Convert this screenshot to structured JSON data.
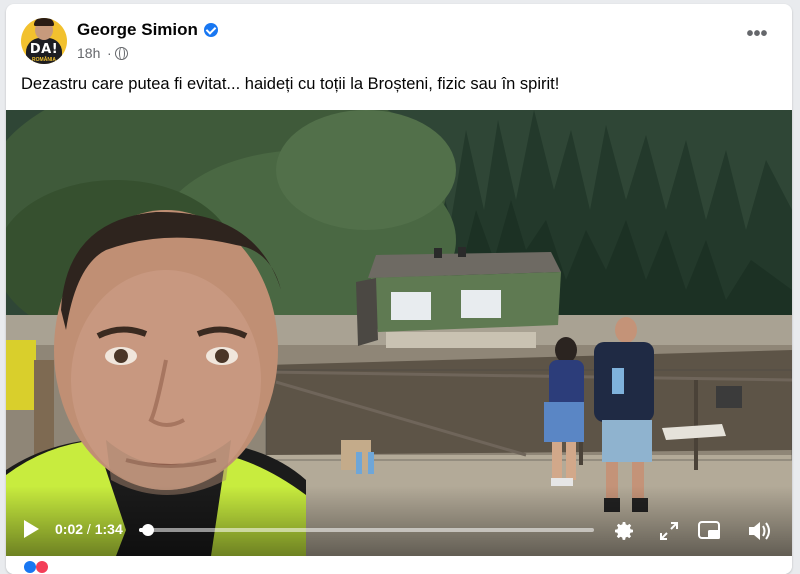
{
  "post": {
    "author": "George Simion",
    "time": "18h",
    "separator": "·",
    "text": "Dezastru care putea fi evitat... haideți cu toții la Broșteni, fizic sau în spirit!",
    "avatar_text": "DA!",
    "avatar_subtext": "ROMÂNIA"
  },
  "video": {
    "current_time": "0:02",
    "time_separator": "/",
    "duration": "1:34",
    "progress": 0.02
  },
  "icons": {
    "verified": "verified-badge-icon",
    "privacy": "globe-icon",
    "more": "more-options-icon",
    "play": "play-icon",
    "settings": "gear-icon",
    "fullscreen": "expand-icon",
    "pip": "picture-in-picture-icon",
    "volume": "volume-icon"
  },
  "colors": {
    "accent": "#1877f2",
    "vest": "#d8f53a"
  }
}
